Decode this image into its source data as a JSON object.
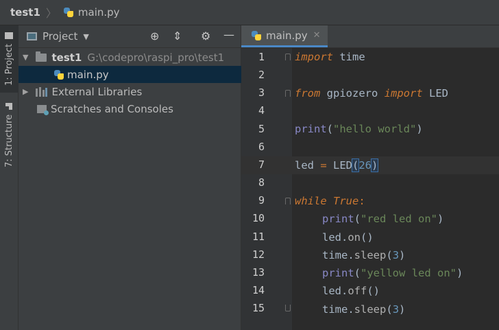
{
  "breadcrumb": {
    "project": "test1",
    "file": "main.py"
  },
  "left_strip": {
    "project_tab": "1: Project",
    "structure_tab": "7: Structure"
  },
  "project_panel": {
    "title": "Project",
    "tree": [
      {
        "label": "test1",
        "path": "G:\\codepro\\raspi_pro\\test1"
      },
      {
        "label": "main.py"
      },
      {
        "label": "External Libraries"
      },
      {
        "label": "Scratches and Consoles"
      }
    ]
  },
  "editor": {
    "tab_label": "main.py",
    "line_numbers": [
      "1",
      "2",
      "3",
      "4",
      "5",
      "6",
      "7",
      "8",
      "9",
      "10",
      "11",
      "12",
      "13",
      "14",
      "15"
    ],
    "lines": [
      {
        "kw1": "import",
        "rest": " time"
      },
      {},
      {
        "kw1": "from",
        "mid": " gpiozero ",
        "kw2": "import",
        "rest": " LED"
      },
      {},
      {
        "fn": "print",
        "p1": "(",
        "str": "\"hello world\"",
        "p2": ")"
      },
      {},
      {
        "a": "led ",
        "op": "=",
        "b": " LED",
        "p1": "(",
        "num": "26",
        "p2": ")"
      },
      {},
      {
        "kw1": "while",
        "sp": " ",
        "kw2": "True",
        "colon": ":"
      },
      {
        "fn": "print",
        "p1": "(",
        "str": "\"red led on\"",
        "p2": ")"
      },
      {
        "obj": "led",
        "dot": ".",
        "m": "on",
        "p": "()"
      },
      {
        "obj": "time",
        "dot": ".",
        "m": "sleep",
        "p1": "(",
        "num": "3",
        "p2": ")"
      },
      {
        "fn": "print",
        "p1": "(",
        "str": "\"yellow led on\"",
        "p2": ")"
      },
      {
        "obj": "led",
        "dot": ".",
        "m": "off",
        "p": "()"
      },
      {
        "obj": "time",
        "dot": ".",
        "m": "sleep",
        "p1": "(",
        "num": "3",
        "p2": ")"
      }
    ]
  },
  "colors": {
    "keyword": "#cc7832",
    "string": "#6a8759",
    "number": "#6897bb",
    "builtin": "#8888c6",
    "selection": "#0d293e",
    "tab_underline": "#4a88c7"
  }
}
